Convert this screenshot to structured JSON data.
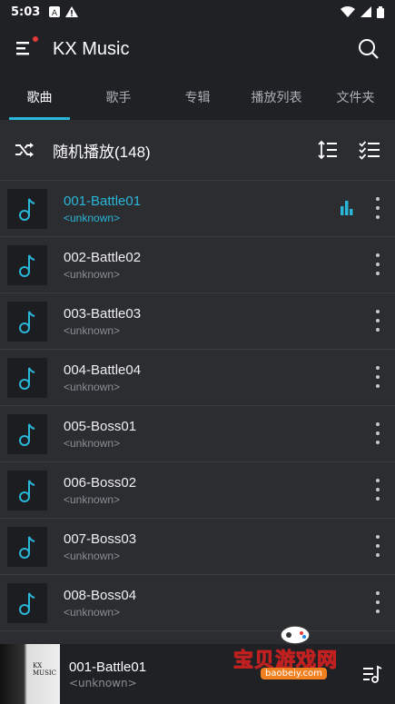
{
  "status": {
    "time": "5:03"
  },
  "app": {
    "title": "KX Music"
  },
  "tabs": [
    {
      "label": "歌曲",
      "active": true
    },
    {
      "label": "歌手"
    },
    {
      "label": "专辑"
    },
    {
      "label": "播放列表"
    },
    {
      "label": "文件夹"
    }
  ],
  "shuffle": {
    "label": "随机播放(148)"
  },
  "songs": [
    {
      "name": "001-Battle01",
      "artist": "<unknown>"
    },
    {
      "name": "002-Battle02",
      "artist": "<unknown>"
    },
    {
      "name": "003-Battle03",
      "artist": "<unknown>"
    },
    {
      "name": "004-Battle04",
      "artist": "<unknown>"
    },
    {
      "name": "005-Boss01",
      "artist": "<unknown>"
    },
    {
      "name": "006-Boss02",
      "artist": "<unknown>"
    },
    {
      "name": "007-Boss03",
      "artist": "<unknown>"
    },
    {
      "name": "008-Boss04",
      "artist": "<unknown>"
    }
  ],
  "player": {
    "name": "001-Battle01",
    "artist": "<unknown>",
    "cover_text": "KX MUSIC"
  },
  "watermark": {
    "text": "宝贝游戏网",
    "url": "baobeiy.com"
  },
  "colors": {
    "accent": "#29b6d8",
    "background": "#2b2d30",
    "bar": "#1f2124"
  }
}
